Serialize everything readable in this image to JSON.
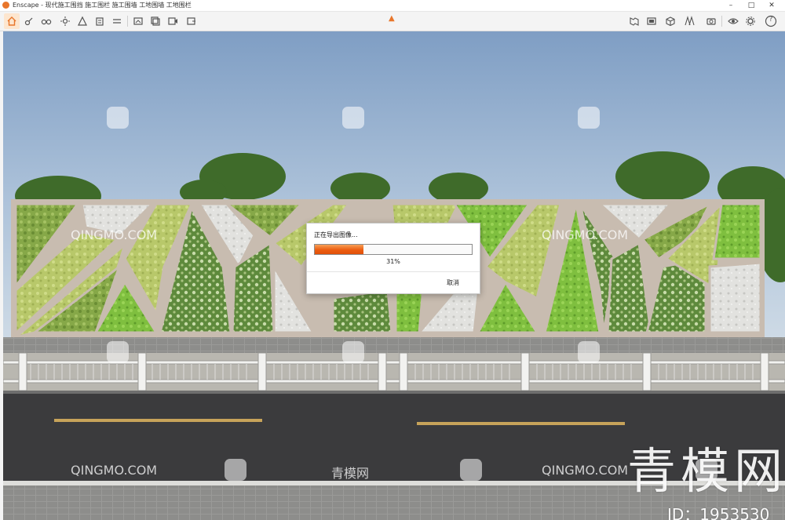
{
  "window": {
    "title": "Enscape - 现代施工围挡 施工围栏 施工围墙 工地围墙 工地围栏",
    "controls": {
      "minimize": "–",
      "maximize": "□",
      "close": "✕"
    }
  },
  "toolbar": {
    "left_icons": [
      "home-icon",
      "walk-icon",
      "binoculars-icon",
      "sun-icon",
      "asset-library-icon",
      "building-icon",
      "sync-icon",
      "export-image-icon",
      "export-batch-icon",
      "export-video-icon"
    ],
    "right_icons": [
      "panorama-icon",
      "video-editor-icon",
      "cube-icon",
      "views-icon",
      "camera-icon",
      "visual-settings-icon",
      "settings-icon",
      "help-icon"
    ],
    "help_label": "?"
  },
  "watermarks": {
    "site_name": "QINGMO.COM",
    "site_name_cn": "青模网",
    "big_logo": "青模网",
    "id_label": "ID：1953530"
  },
  "export_dialog": {
    "title": "正在导出图像...",
    "progress": 0.31,
    "progress_text": "31%",
    "cancel_label": "取消"
  },
  "colors": {
    "accent": "#e8762b",
    "progress_fill": "#ec5d10"
  }
}
